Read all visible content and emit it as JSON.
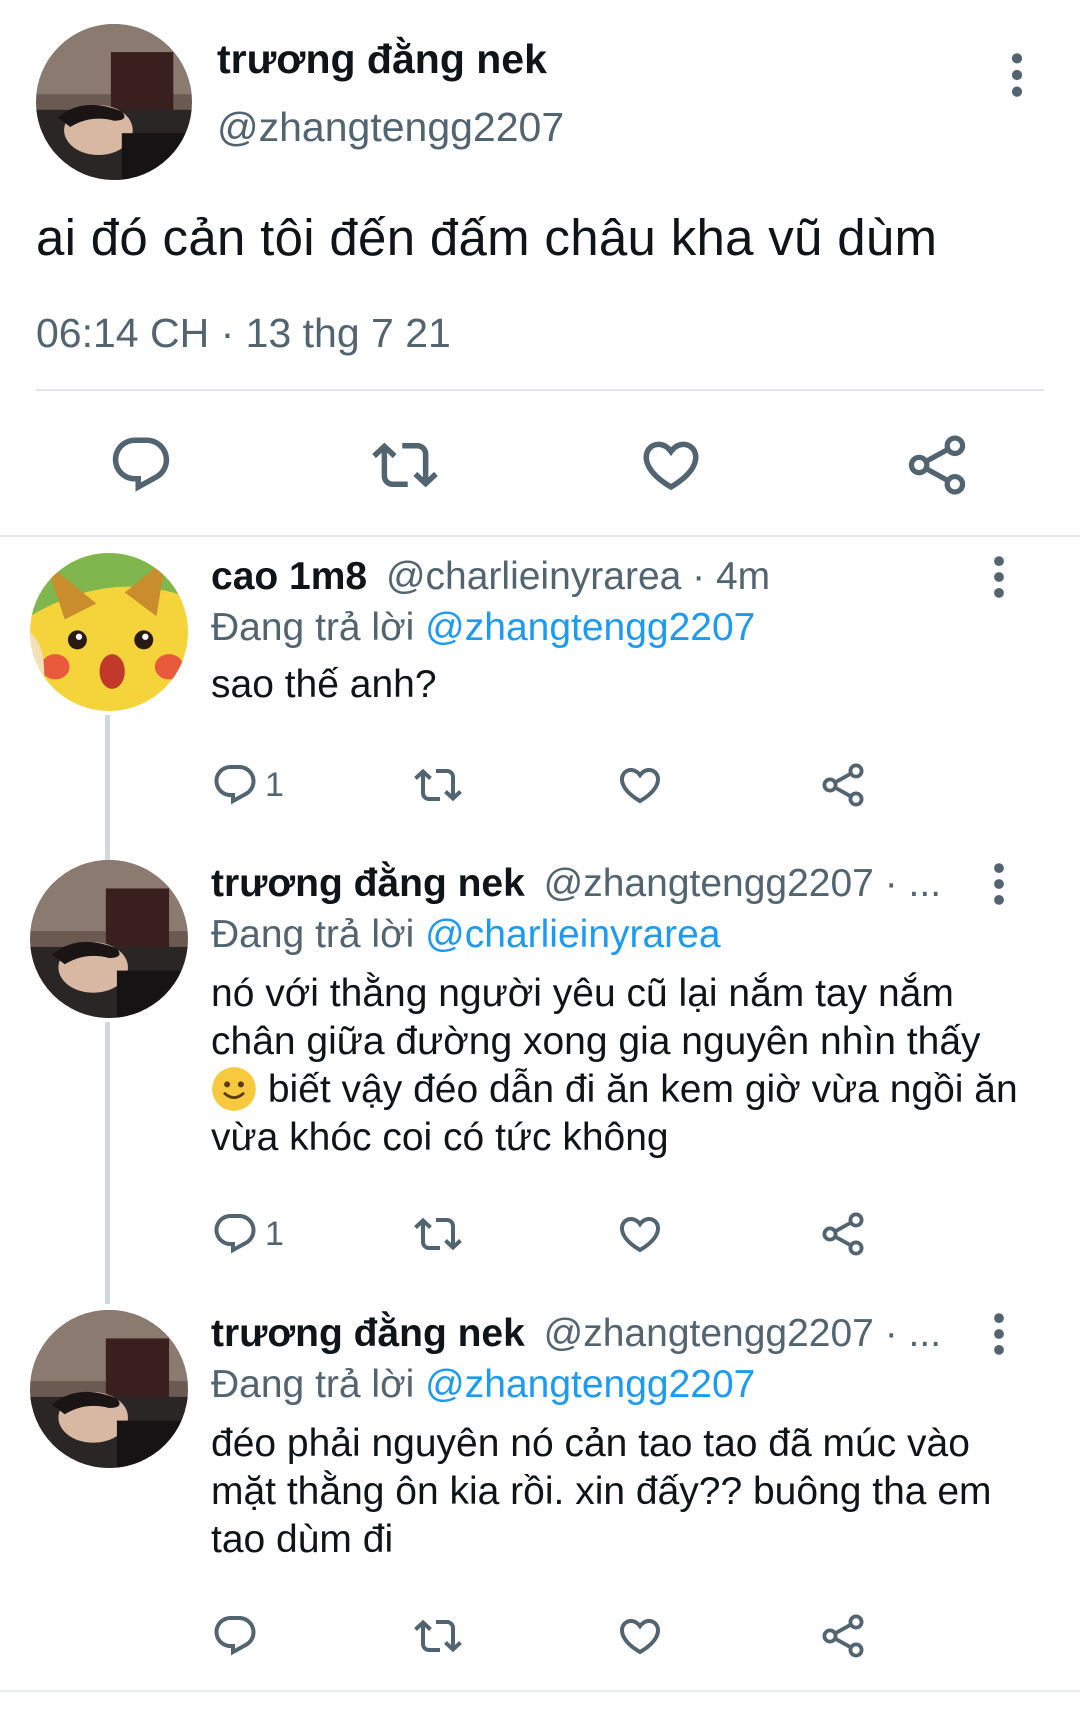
{
  "main_tweet": {
    "display_name": "trương đằng nek",
    "handle": "@zhangtengg2207",
    "text": "ai đó cản tôi đến đấm châu kha vũ dùm",
    "meta": "06:14 CH · 13 thg 7 21",
    "actions": [
      "reply-icon",
      "retweet-icon",
      "like-icon",
      "share-icon"
    ]
  },
  "replies": [
    {
      "display_name": "cao 1m8",
      "handle_meta": "@charlieinyrarea · 4m",
      "replying_label": "Đang trả lời",
      "replying_to": "@zhangtengg2207",
      "text": "sao thế anh?",
      "reply_count": "1"
    },
    {
      "display_name": "trương đằng nek",
      "handle_meta": "@zhangtengg2207 · ...",
      "replying_label": "Đang trả lời",
      "replying_to": "@charlieinyrarea",
      "text_before_emoji": "nó với thằng người yêu cũ lại nắm tay nắm chân giữa đường xong gia nguyên nhìn thấy",
      "text_after_emoji": "biết vậy đéo dẫn đi ăn kem giờ vừa ngồi ăn vừa khóc coi có tức không",
      "reply_count": "1"
    },
    {
      "display_name": "trương đằng nek",
      "handle_meta": "@zhangtengg2207 · ...",
      "replying_label": "Đang trả lời",
      "replying_to": "@zhangtengg2207",
      "text": "đéo phải nguyên nó cản tao tao đã múc vào mặt thằng ôn kia rồi. xin đấy?? buông tha em tao dùm đi",
      "reply_count": ""
    }
  ],
  "colors": {
    "text": "#0f1419",
    "secondary": "#536471",
    "link": "#1d9bf0",
    "divider": "#e1e6ea"
  }
}
